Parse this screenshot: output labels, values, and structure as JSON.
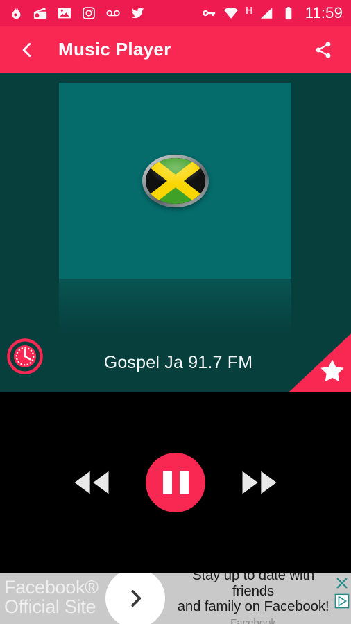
{
  "status_bar": {
    "left_icons": [
      {
        "name": "flame-icon",
        "label": "flame"
      },
      {
        "name": "radio-icon",
        "label": "radio"
      },
      {
        "name": "gallery-icon",
        "label": "photo gallery"
      },
      {
        "name": "instagram-icon",
        "label": "instagram"
      },
      {
        "name": "voicemail-icon",
        "label": "voicemail"
      },
      {
        "name": "twitter-icon",
        "label": "twitter"
      }
    ],
    "right_icons": [
      {
        "name": "vpn-key-icon",
        "label": "vpn key"
      },
      {
        "name": "wifi-icon",
        "label": "wifi"
      },
      {
        "name": "signal-icon",
        "label": "cellular signal"
      },
      {
        "name": "battery-charging-icon",
        "label": "battery charging"
      }
    ],
    "network_type": "H",
    "time": "11:59"
  },
  "app_bar": {
    "back_label": "Back",
    "title": "Music Player",
    "share_label": "Share"
  },
  "now_playing": {
    "artwork_alt": "Jamaica flag",
    "station_name": "Gospel Ja 91.7 FM",
    "timer_label": "Sleep timer",
    "favorite_label": "Favorite"
  },
  "player_controls": {
    "previous_label": "Previous",
    "play_pause_label": "Pause",
    "is_playing": true,
    "next_label": "Next"
  },
  "ad": {
    "brand_line_1": "Facebook®",
    "brand_line_2": "Official Site",
    "headline_line_1": "Stay up to date with friends",
    "headline_line_2": "and family on Facebook!",
    "source": "Facebook",
    "cta_label": "Open",
    "close_label": "Close ad",
    "adchoices_label": "AdChoices"
  },
  "colors": {
    "status_bar": "#ED1B50",
    "app_bar": "#F92853",
    "accent": "#F92853",
    "background": "#073f3d",
    "artwork_bg": "#056b6b",
    "player_bg": "#000000",
    "ad_bg": "#c9c9c9"
  }
}
